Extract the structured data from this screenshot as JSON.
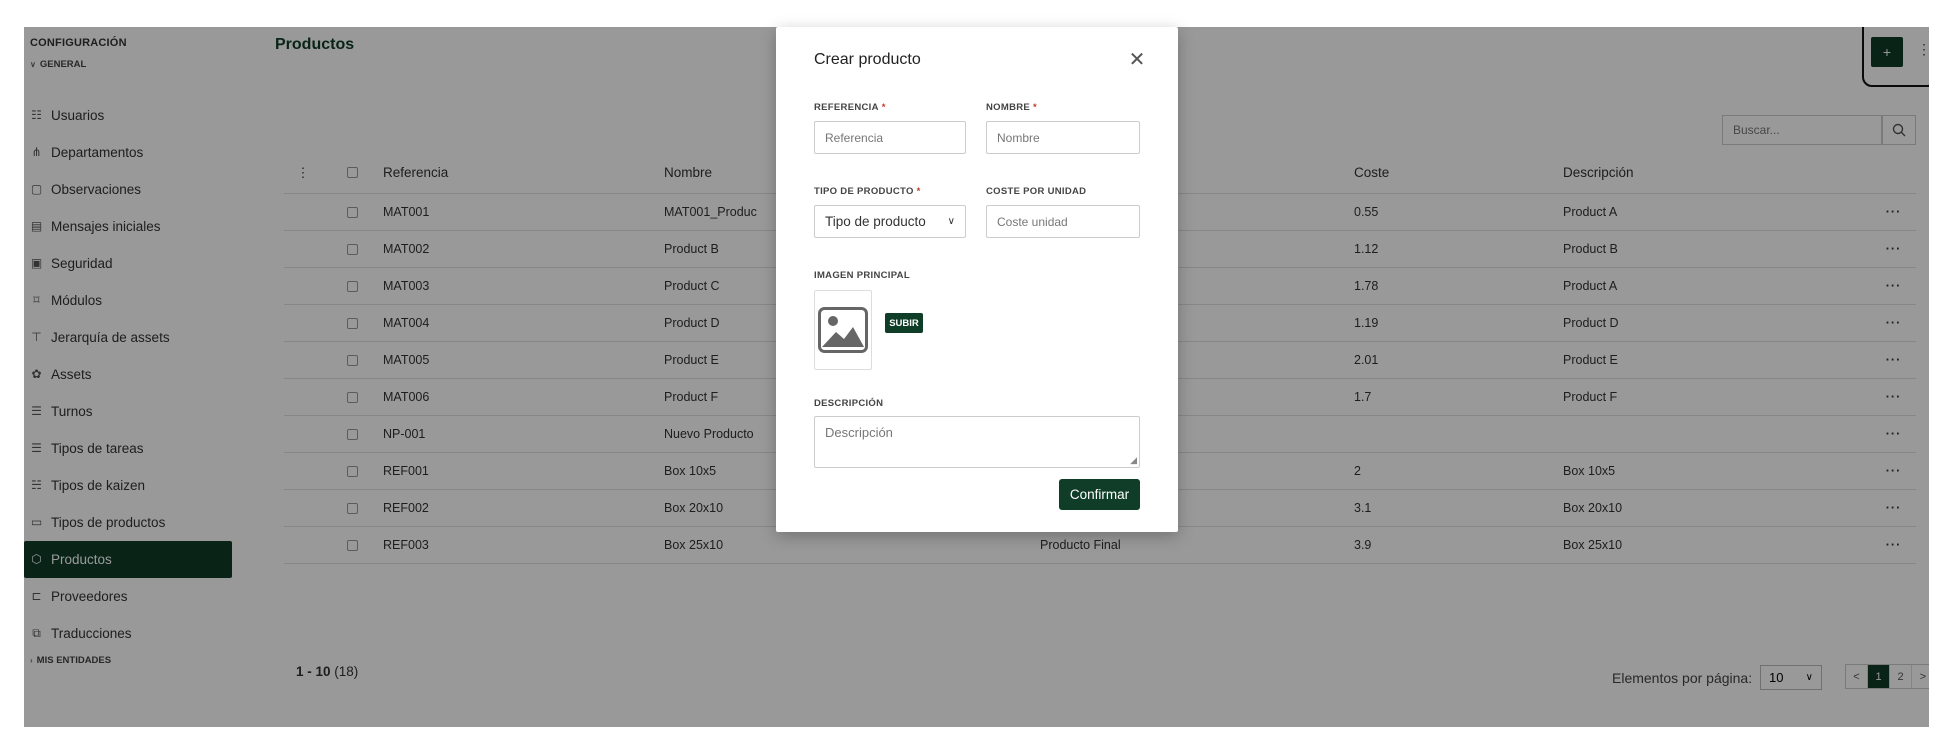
{
  "sidebar": {
    "title": "CONFIGURACIÓN",
    "group_general": "GENERAL",
    "group_entities": "MIS ENTIDADES",
    "items": [
      {
        "label": "Usuarios",
        "icon": "users-icon"
      },
      {
        "label": "Departamentos",
        "icon": "departments-icon"
      },
      {
        "label": "Observaciones",
        "icon": "clipboard-icon"
      },
      {
        "label": "Mensajes iniciales",
        "icon": "message-icon"
      },
      {
        "label": "Seguridad",
        "icon": "security-icon"
      },
      {
        "label": "Módulos",
        "icon": "modules-icon"
      },
      {
        "label": "Jerarquía de assets",
        "icon": "hierarchy-icon"
      },
      {
        "label": "Assets",
        "icon": "gear-icon"
      },
      {
        "label": "Turnos",
        "icon": "list-icon"
      },
      {
        "label": "Tipos de tareas",
        "icon": "tasks-icon"
      },
      {
        "label": "Tipos de kaizen",
        "icon": "kaizen-icon"
      },
      {
        "label": "Tipos de productos",
        "icon": "calendar-icon"
      },
      {
        "label": "Productos",
        "icon": "box-icon"
      },
      {
        "label": "Proveedores",
        "icon": "truck-icon"
      },
      {
        "label": "Traducciones",
        "icon": "translate-icon"
      }
    ],
    "active_index": 12
  },
  "header": {
    "title": "Productos",
    "add_label": "+"
  },
  "search": {
    "placeholder": "Buscar..."
  },
  "table": {
    "columns": [
      "Referencia",
      "Nombre",
      "",
      "Coste",
      "Descripción"
    ],
    "rows": [
      {
        "ref": "MAT001",
        "name": "MAT001_Produc",
        "type": "",
        "cost": "0.55",
        "desc": "Product A"
      },
      {
        "ref": "MAT002",
        "name": "Product B",
        "type": "",
        "cost": "1.12",
        "desc": "Product B"
      },
      {
        "ref": "MAT003",
        "name": "Product C",
        "type": "",
        "cost": "1.78",
        "desc": "Product A"
      },
      {
        "ref": "MAT004",
        "name": "Product D",
        "type": "",
        "cost": "1.19",
        "desc": "Product D"
      },
      {
        "ref": "MAT005",
        "name": "Product E",
        "type": "",
        "cost": "2.01",
        "desc": "Product E"
      },
      {
        "ref": "MAT006",
        "name": "Product F",
        "type": "",
        "cost": "1.7",
        "desc": "Product F"
      },
      {
        "ref": "NP-001",
        "name": "Nuevo Producto",
        "type": "",
        "cost": "",
        "desc": ""
      },
      {
        "ref": "REF001",
        "name": "Box 10x5",
        "type": "",
        "cost": "2",
        "desc": "Box 10x5"
      },
      {
        "ref": "REF002",
        "name": "Box 20x10",
        "type": "",
        "cost": "3.1",
        "desc": "Box 20x10"
      },
      {
        "ref": "REF003",
        "name": "Box 25x10",
        "type": "Producto Final",
        "cost": "3.9",
        "desc": "Box 25x10"
      }
    ],
    "row_action": "···"
  },
  "pagination": {
    "range": "1 - 10",
    "total": "(18)",
    "per_page_label": "Elementos por página:",
    "per_page_value": "10",
    "prev": "<",
    "pages": [
      "1",
      "2"
    ],
    "next": ">",
    "active_page": "1"
  },
  "modal": {
    "title": "Crear producto",
    "reference_label": "REFERENCIA",
    "reference_placeholder": "Referencia",
    "name_label": "NOMBRE",
    "name_placeholder": "Nombre",
    "type_label": "TIPO DE PRODUCTO",
    "type_value": "Tipo de producto",
    "unit_cost_label": "COSTE POR UNIDAD",
    "unit_cost_placeholder": "Coste unidad",
    "image_label": "IMAGEN PRINCIPAL",
    "upload_label": "SUBIR",
    "description_label": "DESCRIPCIÓN",
    "description_placeholder": "Descripción",
    "confirm_label": "Confirmar",
    "required_mark": "*"
  },
  "colors": {
    "brand": "#0f3d27",
    "required": "#c0392b"
  }
}
